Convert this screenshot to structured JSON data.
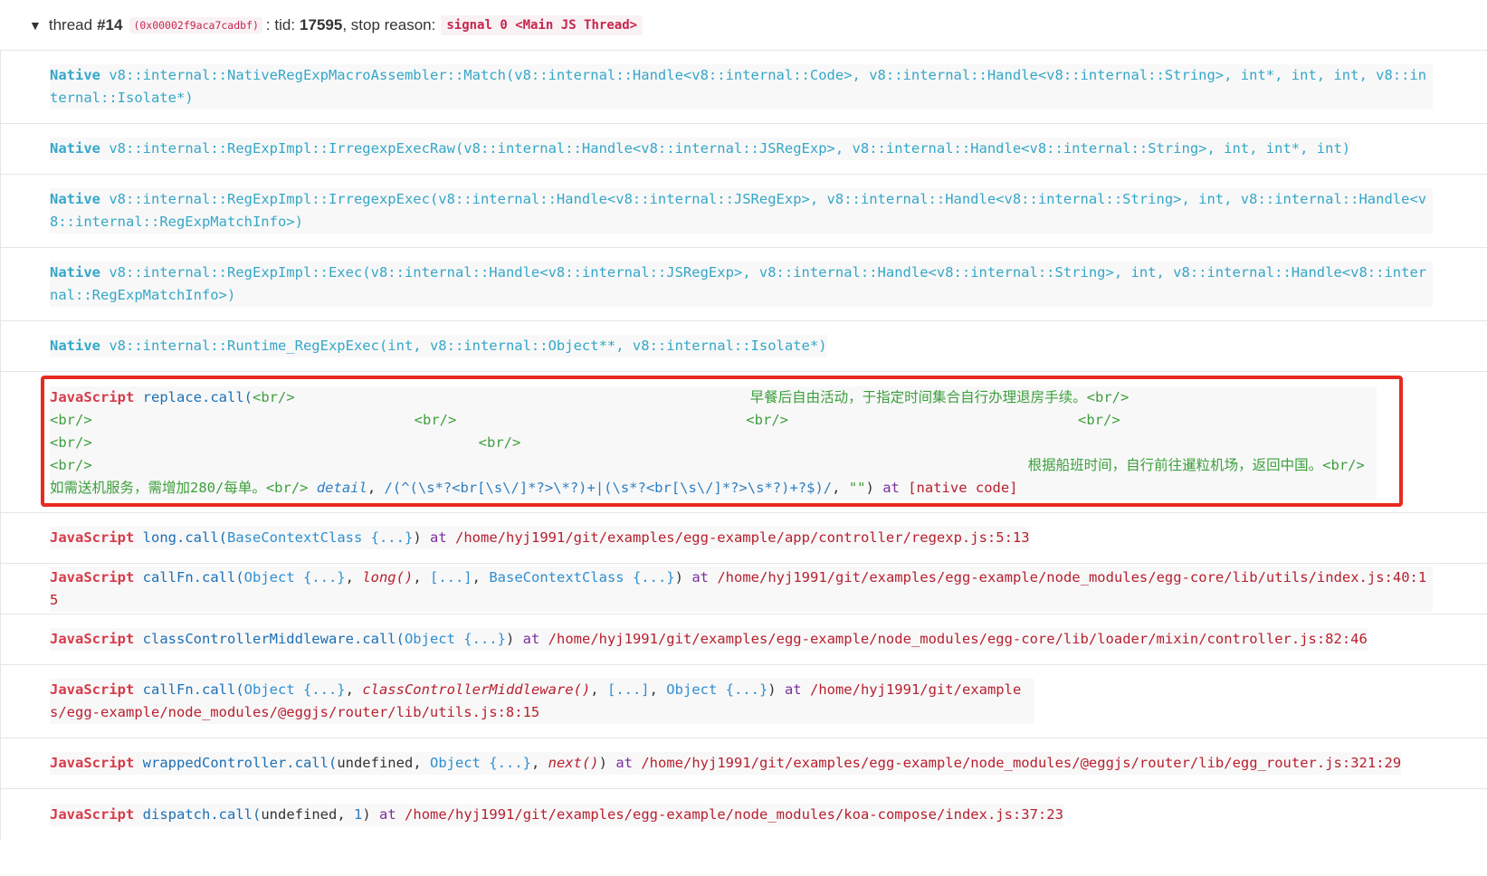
{
  "header": {
    "toggle": "▼",
    "thread_label": "thread",
    "thread_num": "#14",
    "address": "(0x00002f9aca7cadbf)",
    "tid_label": ": tid:",
    "tid": "17595",
    "stop_label": ", stop reason:",
    "stop_reason": "signal 0 <Main JS Thread>"
  },
  "native_frames": [
    {
      "kind": "Native",
      "signature": "v8::internal::NativeRegExpMacroAssembler::Match(v8::internal::Handle<v8::internal::Code>, v8::internal::Handle<v8::internal::String>, int*, int, int, v8::internal::Isolate*)"
    },
    {
      "kind": "Native",
      "signature": "v8::internal::RegExpImpl::IrregexpExecRaw(v8::internal::Handle<v8::internal::JSRegExp>, v8::internal::Handle<v8::internal::String>, int, int*, int)"
    },
    {
      "kind": "Native",
      "signature": "v8::internal::RegExpImpl::IrregexpExec(v8::internal::Handle<v8::internal::JSRegExp>, v8::internal::Handle<v8::internal::String>, int, v8::internal::Handle<v8::internal::RegExpMatchInfo>)"
    },
    {
      "kind": "Native",
      "signature": "v8::internal::RegExpImpl::Exec(v8::internal::Handle<v8::internal::JSRegExp>, v8::internal::Handle<v8::internal::String>, int, v8::internal::Handle<v8::internal::RegExpMatchInfo>)"
    },
    {
      "kind": "Native",
      "signature": "v8::internal::Runtime_RegExpExec(int, v8::internal::Object**, v8::internal::Isolate*)"
    }
  ],
  "replace_frame": {
    "kind": "JavaScript",
    "fn": "replace.call(",
    "line1_start": "<br/>",
    "line1_text": "早餐后自由活动，于指定时间集合自行办理退房手续。<br/>",
    "br": "<br/>",
    "line4_text": "根据船班时间，自行前往暹粒机场，返回中国。<br/>",
    "line5_text": "如需送机服务，需增加280/每单。<br/>",
    "detail": "detail",
    "comma": ",",
    "regex_a": "/(^(\\s*?<br[\\s\\/]*?>\\*?)+",
    "regex_b": "|",
    "regex_c": "(\\s*?<br[\\s\\/]*?>\\s*?)+?$)/",
    "empty_str": "\"\"",
    "close": ")",
    "at": "at",
    "location": "[native code]"
  },
  "js_frames": {
    "long": {
      "kind": "JavaScript",
      "fn": "long.call(",
      "arg1": "BaseContextClass {...}",
      "close": ")",
      "at": "at",
      "path": "/home/hyj1991/git/examples/egg-example/app/controller/regexp.js:5:13"
    },
    "callfn1": {
      "kind": "JavaScript",
      "fn": "callFn.call(",
      "arg1": "Object {...}",
      "fnref": "long()",
      "arr": "[...]",
      "arg4": "BaseContextClass {...}",
      "close": ")",
      "at": "at",
      "path": "/home/hyj1991/git/examples/egg-example/node_modules/egg-core/lib/utils/index.js:40:15"
    },
    "ccm": {
      "kind": "JavaScript",
      "fn": "classControllerMiddleware.call(",
      "arg1": "Object {...}",
      "close": ")",
      "at": "at",
      "path": "/home/hyj1991/git/examples/egg-example/node_modules/egg-core/lib/loader/mixin/controller.js:82:46"
    },
    "callfn2": {
      "kind": "JavaScript",
      "fn": "callFn.call(",
      "arg1": "Object {...}",
      "fnref": "classControllerMiddleware()",
      "arr": "[...]",
      "arg4": "Object {...}",
      "close": ")",
      "at": "at",
      "path": "/home/hyj1991/git/examples/egg-example/node_modules/@eggjs/router/lib/utils.js:8:15"
    },
    "wrapped": {
      "kind": "JavaScript",
      "fn": "wrappedController.call(",
      "undef": "undefined",
      "arg2": "Object {...}",
      "fnref": "next()",
      "close": ")",
      "at": "at",
      "path": "/home/hyj1991/git/examples/egg-example/node_modules/@eggjs/router/lib/egg_router.js:321:29"
    },
    "dispatch": {
      "kind": "JavaScript",
      "fn": "dispatch.call(",
      "undef": "undefined",
      "num": "1",
      "close": ")",
      "at": "at",
      "path": "/home/hyj1991/git/examples/egg-example/node_modules/koa-compose/index.js:37:23"
    }
  },
  "colors": {
    "native": "#35a7c8",
    "javascript": "#d73a49",
    "highlight_border": "#e82a1f",
    "string": "#3d9f3d"
  }
}
